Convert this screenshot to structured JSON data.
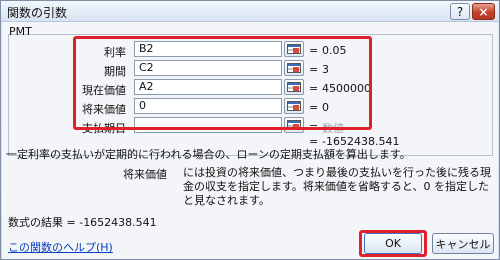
{
  "window": {
    "title": "関数の引数",
    "help_button": "?",
    "close_button": "×"
  },
  "function_name": "PMT",
  "arguments": [
    {
      "label": "利率",
      "value": "B2",
      "result": "0.05"
    },
    {
      "label": "期間",
      "value": "C2",
      "result": "3"
    },
    {
      "label": "現在価値",
      "value": "A2",
      "result": "4500000"
    },
    {
      "label": "将来価値",
      "value": "0",
      "result": "0"
    },
    {
      "label": "支払期日",
      "value": "",
      "result": "数値"
    }
  ],
  "function_result": "-1652438.541",
  "description": "一定利率の支払いが定期的に行われる場合の、ローンの定期支払額を算出します。",
  "argument_help": {
    "name": "将来価値",
    "text": "には投資の将来価値、つまり最後の支払いを行った後に残る現金の収支を指定します。将来価値を省略すると、0 を指定したと見なされます。"
  },
  "formula_result": {
    "label": "数式の結果 =",
    "value": "-1652438.541"
  },
  "help_link": "この関数のヘルプ(H)",
  "buttons": {
    "ok": "OK",
    "cancel": "キャンセル"
  },
  "colors": {
    "highlight": "#e0202a",
    "link": "#0a40c0"
  }
}
